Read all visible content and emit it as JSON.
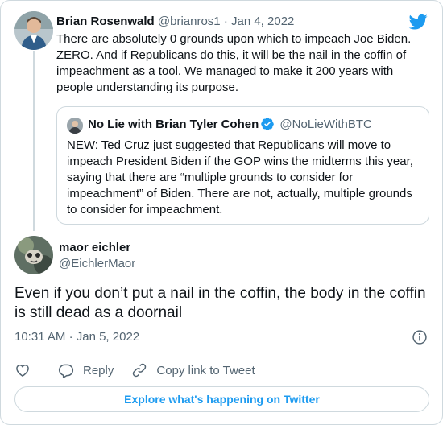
{
  "original_tweet": {
    "author_name": "Brian Rosenwald",
    "handle": "@brianros1",
    "separator": "·",
    "date": "Jan 4, 2022",
    "text": "There are absolutely 0 grounds upon which to impeach Joe Biden. ZERO. And if Republicans do this, it will be the nail in the coffin of impeachment as a tool. We managed to make it 200 years with people understanding its purpose."
  },
  "quoted_tweet": {
    "author_name": "No Lie with Brian Tyler Cohen",
    "handle": "@NoLieWithBTC",
    "text": "NEW: Ted Cruz just suggested that Republicans will move to impeach President Biden if the GOP wins the midterms this year, saying that there are “multiple grounds to consider for impeachment” of Biden. There are not, actually, multiple grounds to consider for impeachment."
  },
  "reply_tweet": {
    "author_name": "maor eichler",
    "handle": "@EichlerMaor",
    "text": "Even if you don’t put a nail in the coffin, the body in the coffin is still dead as a doornail",
    "time": "10:31 AM",
    "separator": "·",
    "date": "Jan 5, 2022"
  },
  "actions": {
    "reply_label": "Reply",
    "copy_link_label": "Copy link to Tweet"
  },
  "explore_label": "Explore what's happening on Twitter",
  "colors": {
    "accent": "#1d9bf0",
    "text": "#0f1419",
    "muted": "#536471",
    "border": "#cfd9de"
  },
  "icons": [
    "twitter-bird-icon",
    "verified-badge-icon",
    "info-icon",
    "heart-icon",
    "reply-icon",
    "link-icon"
  ]
}
